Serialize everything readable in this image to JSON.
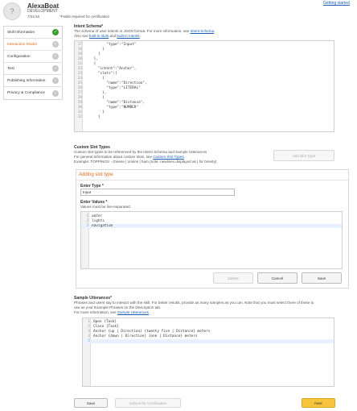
{
  "header": {
    "avatar_glyph": "?",
    "app_name": "AlexaBoat",
    "app_subtitle": "DEVELOPMENT",
    "date": "7/21/16",
    "required_note": "*Fields required for certification",
    "getting_started": "Getting started"
  },
  "sidebar": {
    "items": [
      {
        "label": "Skill Information",
        "status": "complete",
        "status_glyph": "✓"
      },
      {
        "label": "Interaction Model",
        "status": "pending",
        "status_glyph": "✓"
      },
      {
        "label": "Configuration",
        "status": "pending",
        "status_glyph": "✓"
      },
      {
        "label": "Test",
        "status": "pending",
        "status_glyph": "✓"
      },
      {
        "label": "Publishing Information",
        "status": "pending",
        "status_glyph": "✓"
      },
      {
        "label": "Privacy & Compliance",
        "status": "pending",
        "status_glyph": "✓"
      }
    ]
  },
  "intent_schema": {
    "title": "Intent Schema*",
    "desc_1": "The schema of user intents in JSON format. For more information, see ",
    "link_1": "Intent Schema",
    "desc_1_end": ".",
    "desc_2": "Also see ",
    "link_2": "built-in slots",
    "desc_2_mid": " and ",
    "link_3": "built-in intents",
    "desc_2_end": ".",
    "lines": [
      {
        "n": "17",
        "text": "          \"type\":\"Input\""
      },
      {
        "n": "18",
        "text": "        }"
      },
      {
        "n": "19",
        "text": "      ]"
      },
      {
        "n": "20",
        "text": "    },"
      },
      {
        "n": "21",
        "text": "    {"
      },
      {
        "n": "22",
        "text": "      \"intent\":\"Anchor\","
      },
      {
        "n": "23",
        "text": "      \"slots\":["
      },
      {
        "n": "24",
        "text": "        {"
      },
      {
        "n": "25",
        "text": "          \"name\":\"Direction\","
      },
      {
        "n": "26",
        "text": "          \"type\":\"LITERAL\""
      },
      {
        "n": "27",
        "text": "        },"
      },
      {
        "n": "28",
        "text": "        {"
      },
      {
        "n": "29",
        "text": "          \"name\":\"Distance\","
      },
      {
        "n": "30",
        "text": "          \"type\":\"NUMBER\""
      },
      {
        "n": "31",
        "text": "        }"
      },
      {
        "n": "32",
        "text": "      ]"
      }
    ]
  },
  "custom_slots": {
    "title": "Custom Slot Types",
    "desc_1": "Custom slot types to be referenced by the Intent Schema and Sample Utterances",
    "desc_2": "For general information about custom slots, see ",
    "link": "Custom Slot Types",
    "desc_2_end": ".",
    "example": "Example: TOPPINGS - cheese | onions | ham (note: newlines displayed as | for brevity)",
    "add_button": "Add Slot Type",
    "card_title": "Adding slot type",
    "enter_type_label": "Enter Type *",
    "type_value": "Input",
    "enter_values_label": "Enter Values *",
    "values_note": "Values must be line-separated",
    "values_lines": [
      {
        "n": "1",
        "text": "water"
      },
      {
        "n": "2",
        "text": "lights"
      },
      {
        "n": "3",
        "text": "navigation"
      }
    ],
    "delete_button": "Delete",
    "cancel_button": "Cancel",
    "save_button": "Save"
  },
  "sample_utterances": {
    "title": "Sample Utterances*",
    "desc_1": "Phrases and users say to interact with the skill. For better results, provide as many samples as you can. Note that you must select three of these to",
    "desc_2": "use as your Example Phrases on the Description tab.",
    "desc_3": "For more information, see ",
    "link": "Sample Utterances",
    "desc_3_end": ".",
    "lines": [
      {
        "n": "1",
        "text": "Open {Task}"
      },
      {
        "n": "2",
        "text": "Close {Task}"
      },
      {
        "n": "3",
        "text": "Anchor {up | Direction} {twenty five | Distance} meters"
      },
      {
        "n": "4",
        "text": "Anchor {down | Direction} {one | Distance} meters"
      },
      {
        "n": "5",
        "text": ""
      }
    ]
  },
  "footer": {
    "save_button": "Save",
    "submit_button": "Submit for Certification",
    "next_button": "Next"
  },
  "colors": {
    "accent_orange": "#e06a1b",
    "success_green": "#3a9c2f",
    "primary_yellow": "#f7c53d",
    "link_blue": "#1a5fb4"
  }
}
